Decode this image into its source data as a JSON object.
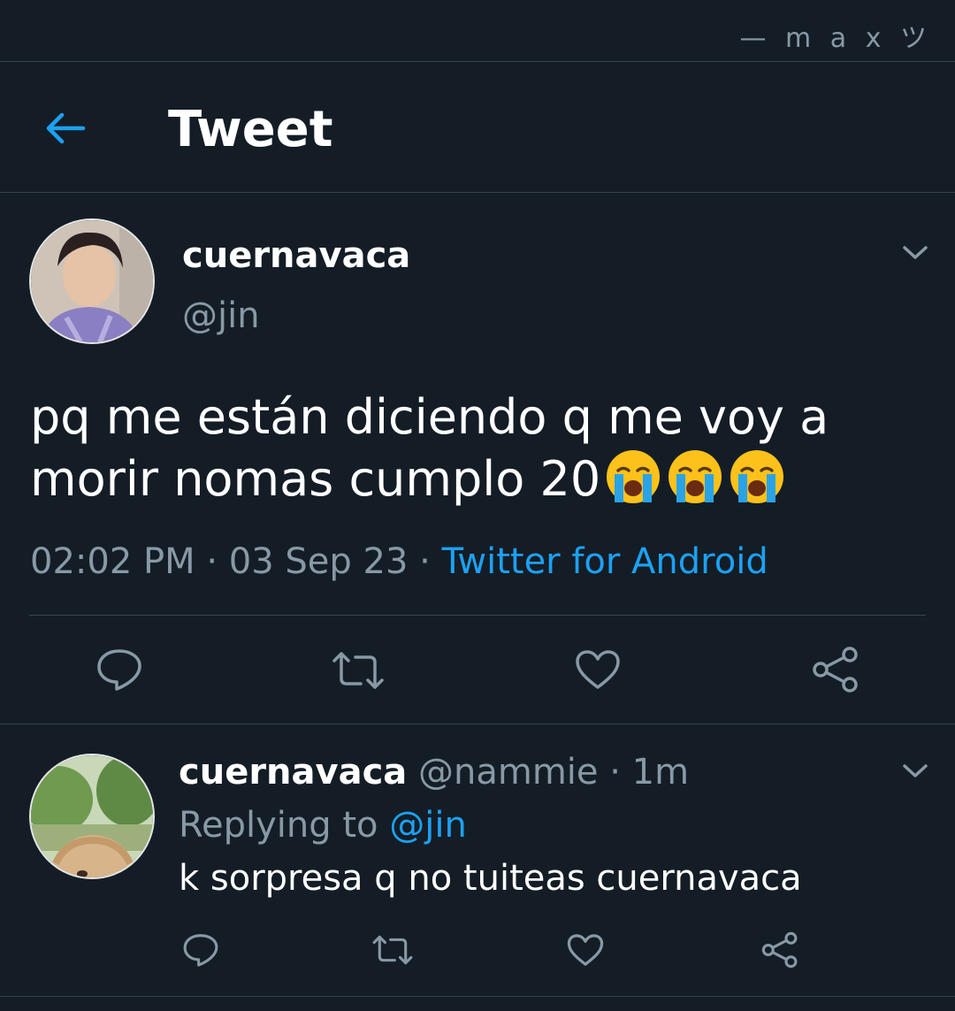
{
  "watermark": "— m a x ツ",
  "header": {
    "title": "Tweet"
  },
  "tweet": {
    "name": "cuernavaca",
    "handle": "@jin",
    "text_line1": "pq me están diciendo q me voy a",
    "text_line2": "morir nomas cumplo 20",
    "emojis": [
      "loudly-crying-face",
      "loudly-crying-face",
      "loudly-crying-face"
    ],
    "time": "02:02 PM",
    "date": "03 Sep 23",
    "source": "Twitter for Android"
  },
  "reply": {
    "name": "cuernavaca",
    "handle": "@nammie",
    "age": "1m",
    "replying_label": "Replying to",
    "replying_to": "@jin",
    "text": "k sorpresa q no tuiteas cuernavaca"
  },
  "colors": {
    "background": "#141d26",
    "divider": "#38444d",
    "accent": "#1da1f2",
    "secondary_text": "#8899a6"
  },
  "icons": {
    "back": "arrow-left-icon",
    "menu": "chevron-down-icon",
    "reply": "comment-icon",
    "retweet": "retweet-icon",
    "like": "heart-icon",
    "share": "share-icon"
  }
}
